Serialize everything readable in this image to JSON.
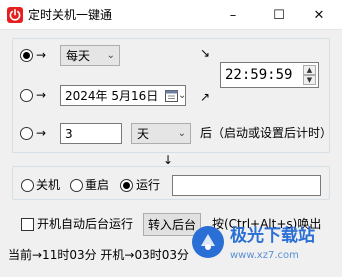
{
  "window": {
    "title": "定时关机一键通",
    "minimize_glyph": "–",
    "maximize_glyph": "☐",
    "close_glyph": "✕"
  },
  "schedule": {
    "arrow": "→",
    "daily": {
      "checked": true,
      "frequency": "每天"
    },
    "date": {
      "checked": false,
      "value": "2024年  5月16日"
    },
    "countdown": {
      "checked": false,
      "amount": "3",
      "unit": "天",
      "suffix": "后（启动或设置后计时）"
    },
    "diag_arrow_top": "↘",
    "diag_arrow_bottom": "↗",
    "time": "22:59:59"
  },
  "down_arrow": "↓",
  "action": {
    "options": [
      {
        "label": "关机",
        "checked": false
      },
      {
        "label": "重启",
        "checked": false
      },
      {
        "label": "运行",
        "checked": true
      }
    ],
    "run_command": ""
  },
  "autostart": {
    "label": "开机自动后台运行",
    "checked": false,
    "to_background_button": "转入后台",
    "hotkey_hint": "按(Ctrl+Alt+s)唤出"
  },
  "status": "当前→11时03分  开机→03时03分",
  "watermark": {
    "brand": "极光下载站",
    "url": "www.xz7.com"
  },
  "colors": {
    "app_icon": "#e51f1f",
    "watermark": "#2a6fd6"
  },
  "icons": {
    "app": "power-icon",
    "calendar": "calendar-icon",
    "spin_up": "spin-up-icon",
    "spin_down": "spin-down-icon"
  }
}
